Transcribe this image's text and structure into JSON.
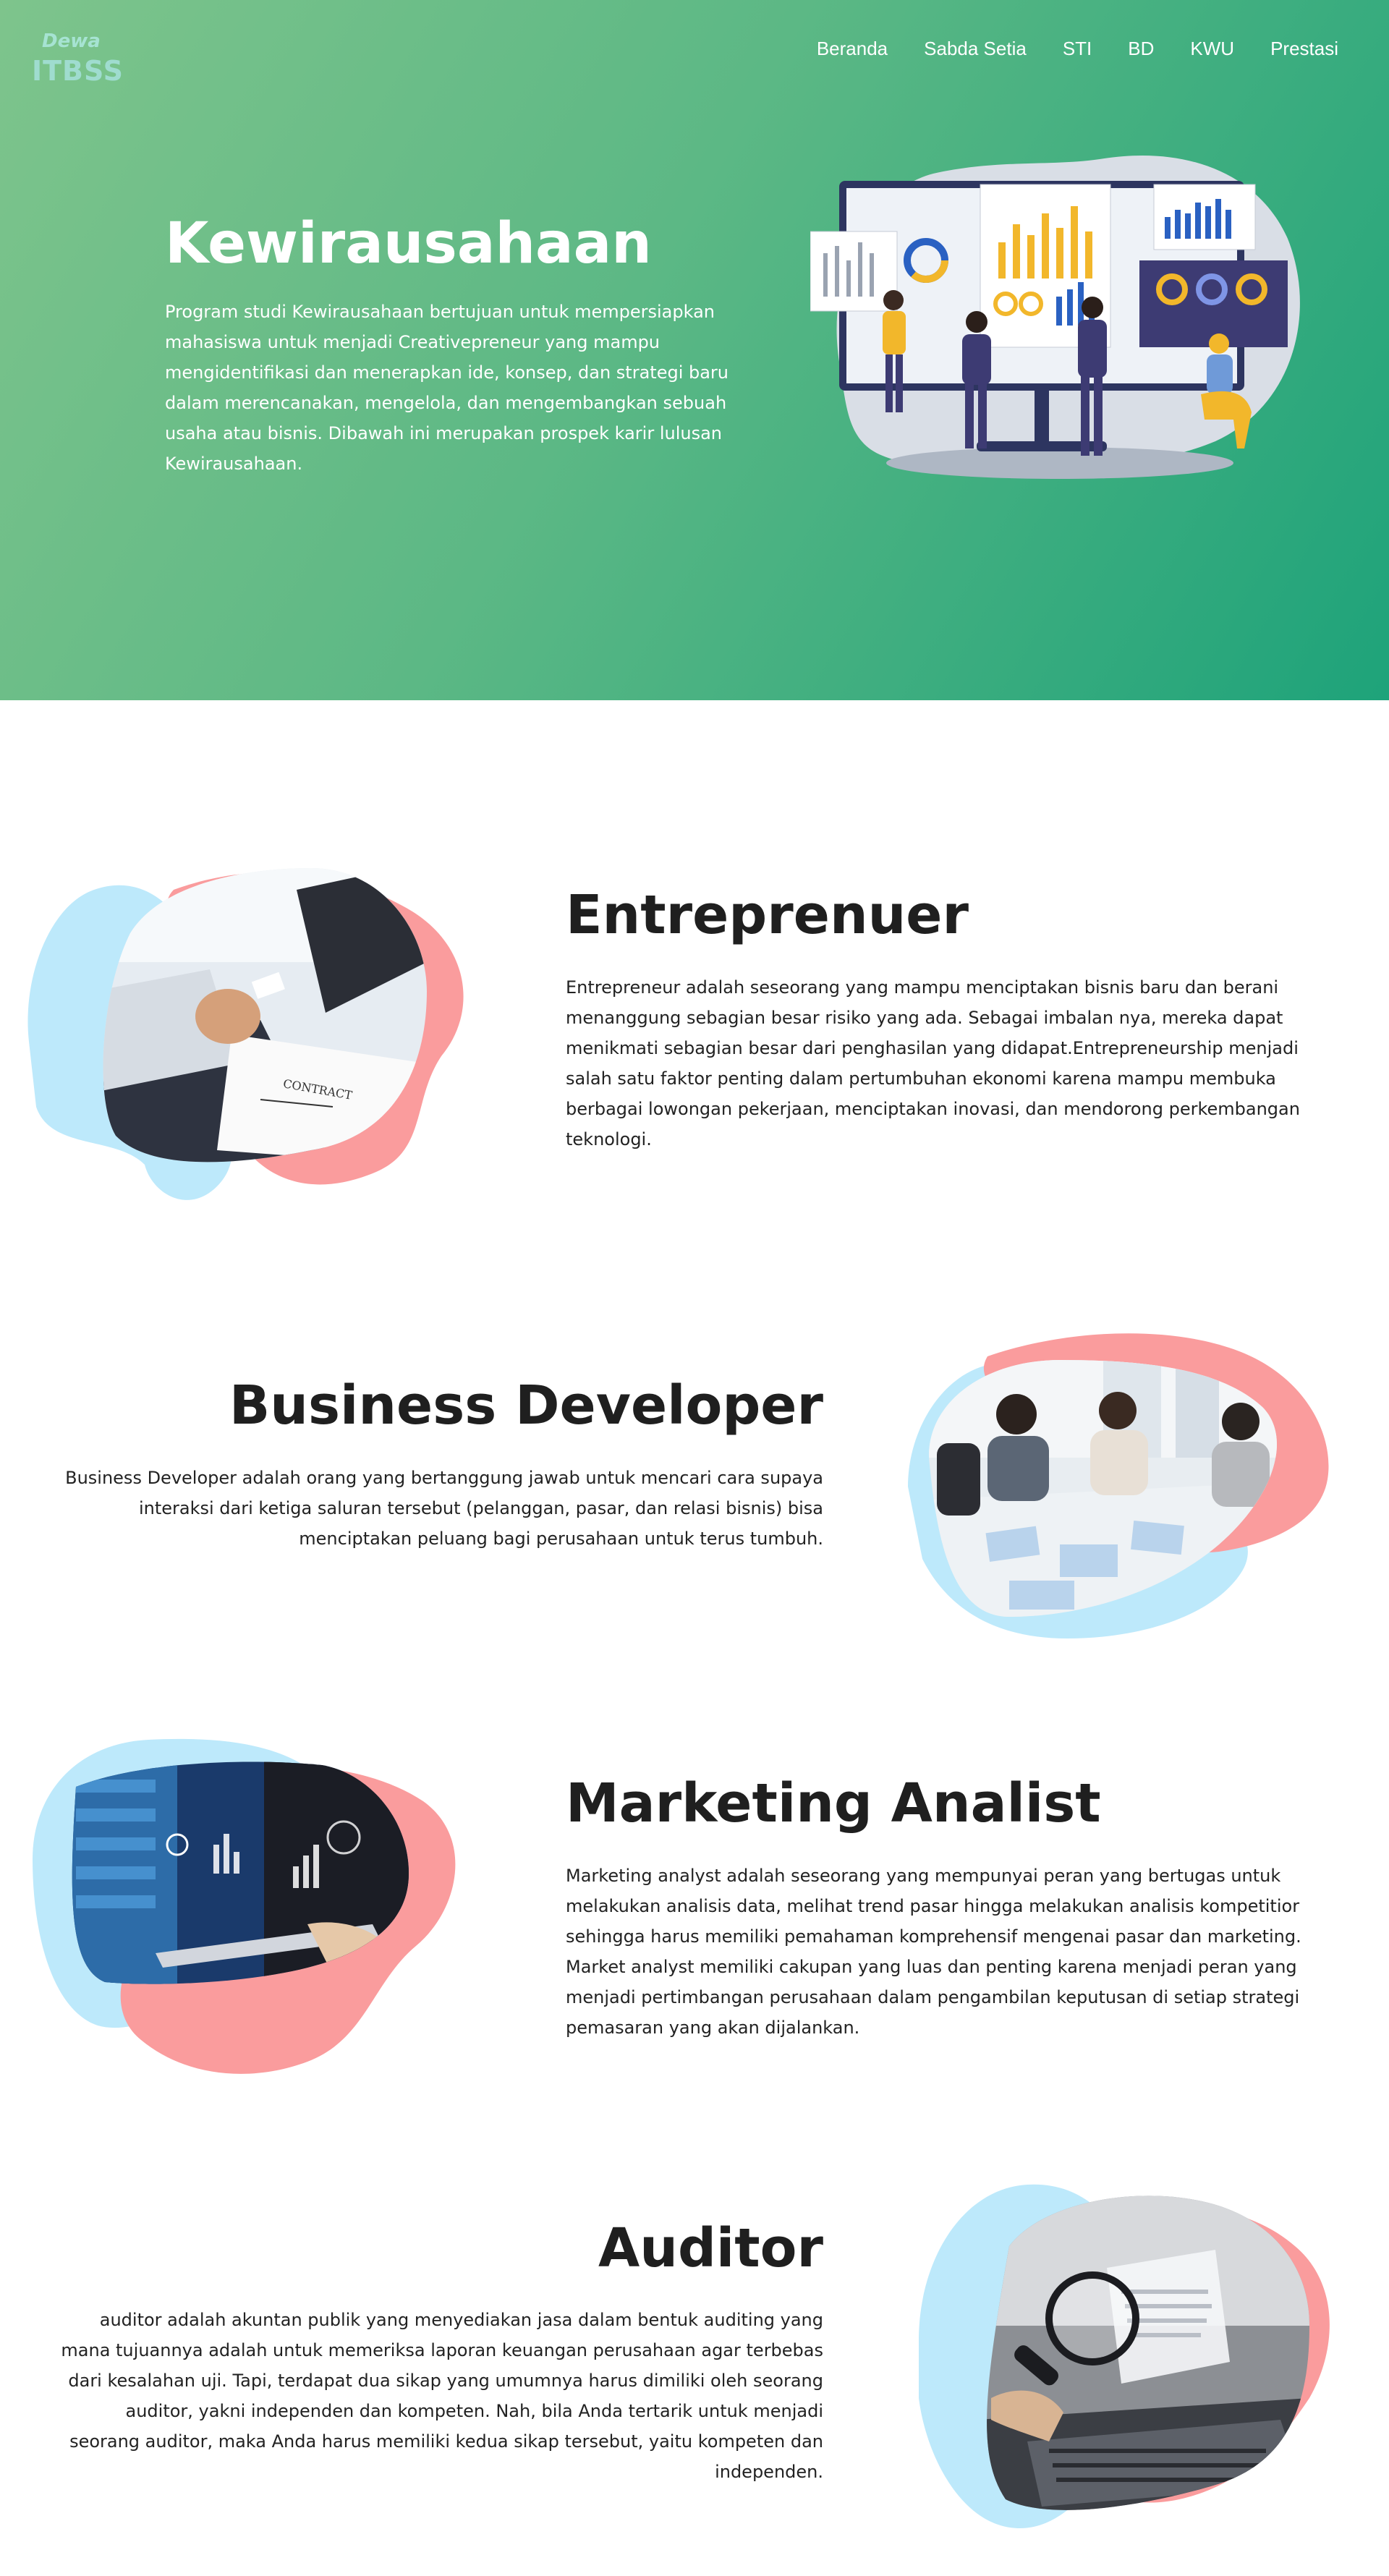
{
  "logo": {
    "line1": "Dewa",
    "line2": "ITBSS"
  },
  "nav": [
    {
      "label": "Beranda"
    },
    {
      "label": "Sabda Setia"
    },
    {
      "label": "STI"
    },
    {
      "label": "BD"
    },
    {
      "label": "KWU"
    },
    {
      "label": "Prestasi"
    }
  ],
  "hero": {
    "title": "Kewirausahaan",
    "text": "Program studi Kewirausahaan bertujuan untuk mempersiapkan mahasiswa untuk menjadi Creativepreneur yang mampu mengidentifikasi dan menerapkan ide, konsep, dan strategi baru dalam merencanakan, mengelola, dan mengembangkan sebuah usaha atau bisnis. Dibawah ini merupakan prospek karir lulusan Kewirausahaan."
  },
  "sections": [
    {
      "title": "Entreprenuer",
      "text": "Entrepreneur adalah seseorang yang mampu menciptakan bisnis baru dan berani menanggung sebagian besar risiko yang ada. Sebagai imbalan nya, mereka dapat menikmati sebagian besar dari penghasilan yang didapat.Entrepreneurship menjadi salah satu faktor penting dalam pertumbuhan ekonomi karena mampu membuka berbagai lowongan pekerjaan, menciptakan inovasi, dan mendorong perkembangan teknologi.",
      "image_label": "CONTRACT"
    },
    {
      "title": "Business Developer",
      "text": "Business Developer adalah orang yang bertanggung jawab untuk mencari cara supaya interaksi dari ketiga saluran tersebut (pelanggan, pasar, dan relasi bisnis) bisa menciptakan peluang bagi perusahaan untuk terus tumbuh."
    },
    {
      "title": "Marketing Analist",
      "text": "Marketing analyst adalah seseorang yang mempunyai peran yang bertugas untuk melakukan analisis data, melihat trend pasar hingga melakukan analisis kompetitior sehingga harus memiliki pemahaman komprehensif mengenai pasar dan marketing. Market analyst memiliki cakupan yang luas dan penting karena menjadi peran yang menjadi pertimbangan perusahaan dalam pengambilan keputusan di setiap strategi pemasaran yang akan dijalankan."
    },
    {
      "title": "Auditor",
      "text": "auditor adalah akuntan publik yang menyediakan jasa dalam bentuk auditing yang mana tujuannya adalah untuk memeriksa laporan keuangan perusahaan agar terbebas dari kesalahan uji. Tapi, terdapat dua sikap yang umumnya harus dimiliki oleh seorang auditor, yakni independen dan kompeten. Nah, bila Anda tertarik untuk menjadi seorang auditor, maka Anda harus memiliki kedua sikap tersebut, yaitu kompeten dan independen."
    }
  ],
  "colors": {
    "hero_start": "#7ec48c",
    "hero_end": "#1ea37a",
    "blob_blue": "#bde9fb",
    "blob_pink": "#fa9c9d"
  }
}
